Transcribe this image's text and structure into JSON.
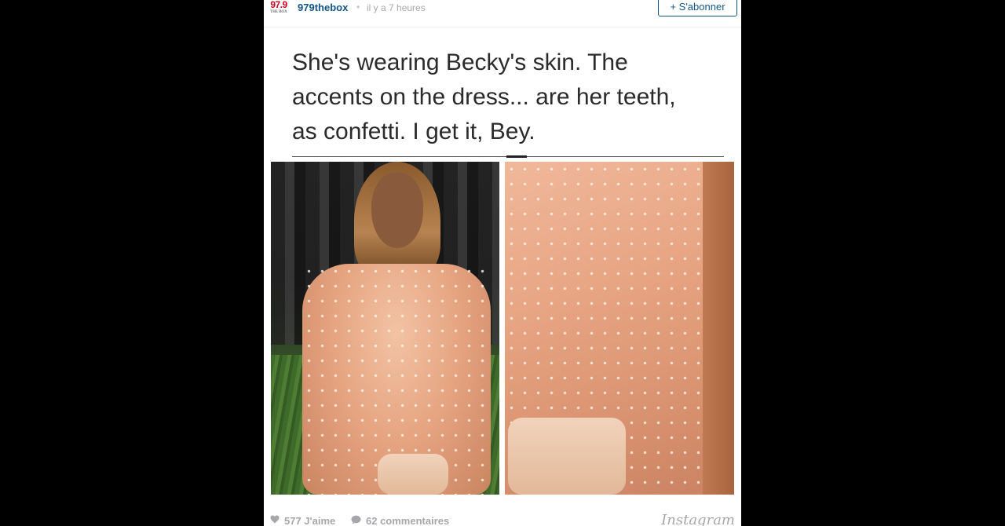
{
  "header": {
    "logo_text": "97.9",
    "logo_subtext": "THE BOX",
    "username": "979thebox",
    "separator": "•",
    "time": "il y a 7 heures",
    "follow_label": "+ S'abonner"
  },
  "caption": {
    "lines": [
      "She's wearing Becky's skin. The",
      "accents on the dress... are her teeth,",
      "as confetti. I get it, Bey."
    ]
  },
  "footer": {
    "likes": "577 J'aime",
    "comments": "62 commentaires",
    "brand": "Instagram"
  },
  "colors": {
    "link": "#125688",
    "muted": "#a5a7aa",
    "background": "#000000",
    "card": "#ffffff"
  }
}
